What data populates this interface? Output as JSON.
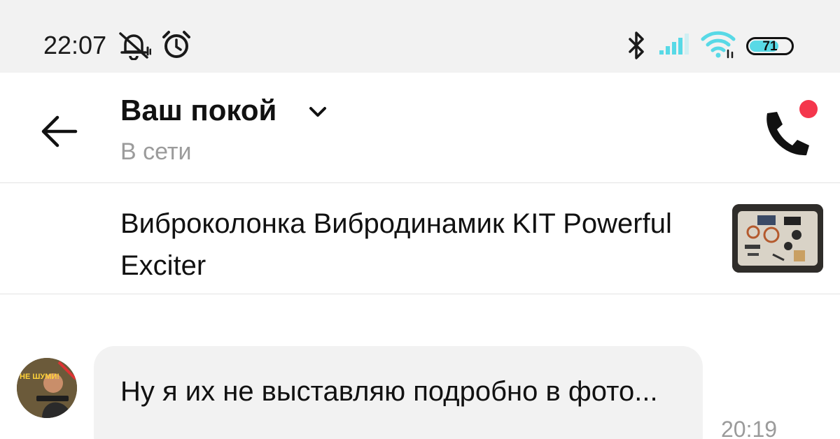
{
  "status_bar": {
    "time": "22:07",
    "icons": [
      "muted-bell-icon",
      "alarm-icon",
      "bluetooth-icon",
      "cell-signal-icon",
      "wifi-icon"
    ],
    "battery": "71",
    "battery_level_percent": 71,
    "accent_color": "#58d9e6"
  },
  "header": {
    "contact_name": "Ваш покой",
    "status": "В сети",
    "icons": [
      "back-arrow-icon",
      "chevron-down-icon",
      "phone-icon"
    ],
    "notification_dot_color": "#f4364c"
  },
  "product": {
    "title": "Виброколонка Вибродинамик KIT Powerful Exciter"
  },
  "messages": [
    {
      "text": "Ну я их не выставляю подробно в фото...",
      "time": "20:19",
      "avatar_caption": "НЕ ШУМИ!"
    }
  ]
}
